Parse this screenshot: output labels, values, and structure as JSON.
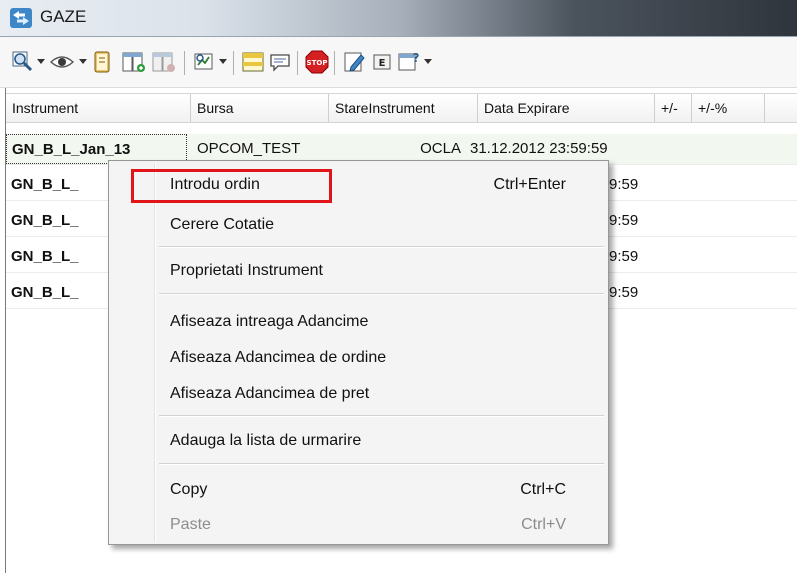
{
  "window": {
    "title": "GAZE"
  },
  "columns": [
    {
      "label": "Instrument"
    },
    {
      "label": "Bursa"
    },
    {
      "label": "StareInstrument"
    },
    {
      "label": "Data Expirare"
    },
    {
      "label": "+/-"
    },
    {
      "label": "+/-%"
    }
  ],
  "rows": [
    {
      "instrument": "GN_B_L_Jan_13",
      "bursa": "OPCOM_TEST",
      "stare": "OCLA",
      "expirare": "31.12.2012 23:59:59"
    },
    {
      "instrument": "GN_B_L_",
      "expirare": "9:59"
    },
    {
      "instrument": "GN_B_L_",
      "expirare": "9:59"
    },
    {
      "instrument": "GN_B_L_",
      "expirare": "9:59"
    },
    {
      "instrument": "GN_B_L_",
      "expirare": "9:59"
    }
  ],
  "context_menu": {
    "items": [
      {
        "label": "Introdu ordin",
        "shortcut": "Ctrl+Enter"
      },
      {
        "label": "Cerere Cotatie"
      },
      {
        "label": "Proprietati Instrument"
      },
      {
        "label": "Afiseaza intreaga Adancime"
      },
      {
        "label": "Afiseaza Adancimea de ordine"
      },
      {
        "label": "Afiseaza Adancimea de pret"
      },
      {
        "label": "Adauga la lista de urmarire"
      },
      {
        "label": "Copy",
        "shortcut": "Ctrl+C"
      },
      {
        "label": "Paste",
        "shortcut": "Ctrl+V",
        "disabled": true
      }
    ]
  },
  "colors": {
    "highlight_box": "#e1141a",
    "selected_row": "#f2f8ef"
  },
  "icons": [
    "search-icon",
    "eye-icon",
    "book-icon",
    "column-add-icon",
    "column-remove-icon",
    "refresh-chart-icon",
    "split-panel-icon",
    "chat-icon",
    "stop-icon",
    "edit-icon",
    "e-badge-icon",
    "help-panel-icon"
  ]
}
